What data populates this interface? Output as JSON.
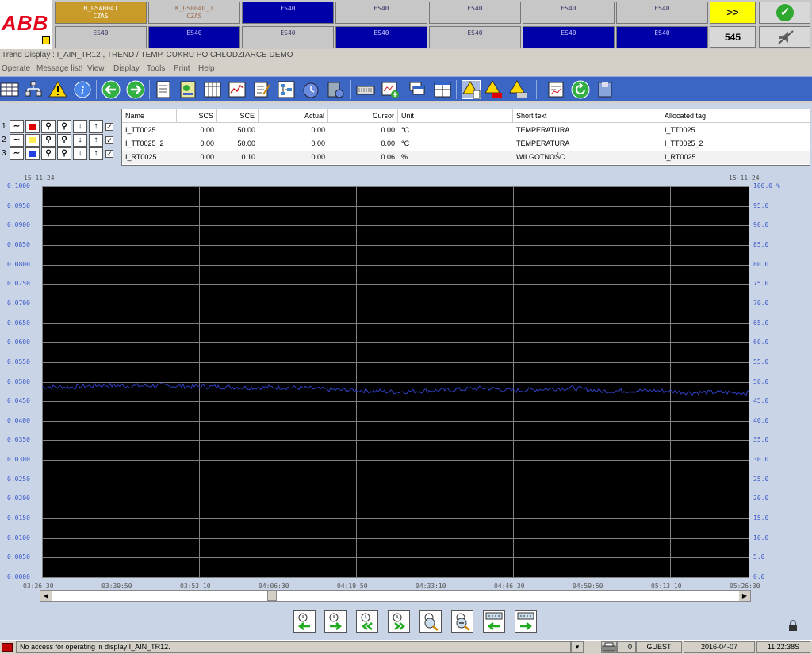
{
  "header": {
    "logo_text": "ABB",
    "row1": [
      {
        "l1": "H_GSA0041",
        "l2": "CZAS",
        "style": "orange"
      },
      {
        "l1": "K_GS0040_1",
        "l2": "CZAS",
        "style": "gray2"
      },
      {
        "l1": "ES40",
        "l2": "",
        "style": "blue"
      },
      {
        "l1": "ES40",
        "l2": "",
        "style": "gray"
      },
      {
        "l1": "ES40",
        "l2": "",
        "style": "gray"
      },
      {
        "l1": "ES40",
        "l2": "",
        "style": "gray"
      },
      {
        "l1": "ES40",
        "l2": "",
        "style": "gray"
      }
    ],
    "row2": [
      {
        "l1": "ES40",
        "style": "gray"
      },
      {
        "l1": "ES40",
        "style": "blue"
      },
      {
        "l1": "ES40",
        "style": "gray"
      },
      {
        "l1": "ES40",
        "style": "blue"
      },
      {
        "l1": "ES40",
        "style": "gray"
      },
      {
        "l1": "ES40",
        "style": "blue"
      },
      {
        "l1": "ES40",
        "style": "blue"
      }
    ],
    "ack_label": ">>",
    "alarm_count": "545"
  },
  "title": "Trend Display : I_AIN_TR12 , TREND / TEMP. CUKRU PO CHŁODZIARCE  DEMO",
  "menu": [
    "Operate",
    "Message list!",
    "View",
    "Display",
    "Tools",
    "Print",
    "Help"
  ],
  "pens": {
    "columns": [
      "Name",
      "SCS",
      "SCE",
      "Actual",
      "Cursor",
      "Unit",
      "Short text",
      "Allocated tag"
    ],
    "rows": [
      {
        "num": "1",
        "color": "#e00000",
        "name": "I_TT0025",
        "scs": "0.00",
        "sce": "50.00",
        "actual": "0.00",
        "cursor": "0.00",
        "unit": "°C",
        "short": "TEMPERATURA",
        "tag": "I_TT0025"
      },
      {
        "num": "2",
        "color": "#ffee55",
        "name": "I_TT0025_2",
        "scs": "0.00",
        "sce": "50.00",
        "actual": "0.00",
        "cursor": "0.00",
        "unit": "°C",
        "short": "TEMPERATURA",
        "tag": "I_TT0025_2"
      },
      {
        "num": "3",
        "color": "#2040e0",
        "name": "I_RT0025",
        "scs": "0.00",
        "sce": "0.10",
        "actual": "0.00",
        "cursor": "0.06",
        "unit": "%",
        "short": "WILGOTNOŚC",
        "tag": "I_RT0025"
      }
    ]
  },
  "chart_data": {
    "type": "line",
    "date_left": "15-11-24",
    "date_right": "15-11-24",
    "y_left_ticks": [
      "0.1000",
      "0.0950",
      "0.0900",
      "0.0850",
      "0.0800",
      "0.0750",
      "0.0700",
      "0.0650",
      "0.0600",
      "0.0550",
      "0.0500",
      "0.0450",
      "0.0400",
      "0.0350",
      "0.0300",
      "0.0250",
      "0.0200",
      "0.0150",
      "0.0100",
      "0.0050",
      "0.0000"
    ],
    "y_right_ticks": [
      "100.0 %",
      "95.0",
      "90.0",
      "85.0",
      "80.0",
      "75.0",
      "70.0",
      "65.0",
      "60.0",
      "55.0",
      "50.0",
      "45.0",
      "40.0",
      "35.0",
      "30.0",
      "25.0",
      "20.0",
      "15.0",
      "10.0",
      "5.0",
      "0.0"
    ],
    "x_ticks": [
      "03:26:30",
      "03:39:50",
      "03:53:10",
      "04:06:30",
      "04:19:50",
      "04:33:10",
      "04:46:30",
      "04:59:50",
      "05:13:10",
      "05:26:30"
    ],
    "ylim": [
      0,
      0.1
    ],
    "grid": true,
    "series": [
      {
        "name": "I_RT0025",
        "color": "#3040c0",
        "x_minutes": [
          0,
          5,
          10,
          15,
          20,
          25,
          30,
          35,
          40,
          45,
          50,
          55,
          60,
          65,
          70,
          75,
          80,
          85,
          90,
          95,
          100,
          105,
          110,
          115,
          120
        ],
        "values": [
          0.0488,
          0.0487,
          0.0492,
          0.049,
          0.0491,
          0.0489,
          0.0488,
          0.0486,
          0.0487,
          0.0484,
          0.048,
          0.0478,
          0.0475,
          0.0478,
          0.048,
          0.0485,
          0.0478,
          0.0482,
          0.0485,
          0.0477,
          0.0478,
          0.0478,
          0.0473,
          0.0474,
          0.0472
        ]
      }
    ]
  },
  "status": {
    "message": "No access for operating in display I_AIN_TR12.",
    "printer_count": "0",
    "user": "GUEST",
    "date": "2016-04-07",
    "time": "11:22:38S"
  }
}
